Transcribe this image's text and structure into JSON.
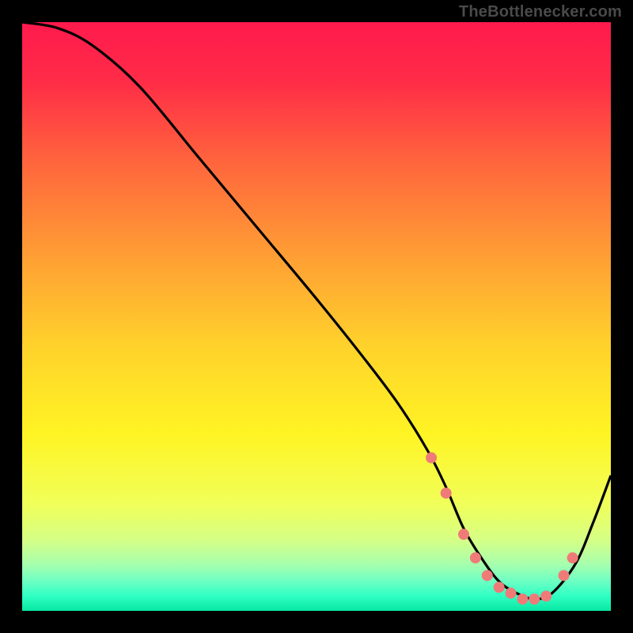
{
  "attribution": "TheBottlenecker.com",
  "chart_data": {
    "type": "line",
    "title": "",
    "xlabel": "",
    "ylabel": "",
    "xlim": [
      0,
      100
    ],
    "ylim": [
      0,
      100
    ],
    "gradient_stops": [
      {
        "offset": 0.0,
        "color": "#ff1a4d"
      },
      {
        "offset": 0.1,
        "color": "#ff2c47"
      },
      {
        "offset": 0.25,
        "color": "#ff6a3c"
      },
      {
        "offset": 0.4,
        "color": "#ff9f34"
      },
      {
        "offset": 0.55,
        "color": "#ffd22b"
      },
      {
        "offset": 0.7,
        "color": "#fff424"
      },
      {
        "offset": 0.82,
        "color": "#f0ff5a"
      },
      {
        "offset": 0.88,
        "color": "#d5ff86"
      },
      {
        "offset": 0.92,
        "color": "#a8ffad"
      },
      {
        "offset": 0.95,
        "color": "#6cffc3"
      },
      {
        "offset": 0.975,
        "color": "#2effc3"
      },
      {
        "offset": 1.0,
        "color": "#08e8a3"
      }
    ],
    "series": [
      {
        "name": "bottleneck-curve",
        "x": [
          0,
          6,
          12,
          20,
          30,
          40,
          50,
          58,
          64,
          69,
          72,
          75,
          78,
          81,
          84,
          87,
          90,
          94,
          97,
          100
        ],
        "y": [
          100,
          99,
          96,
          89,
          77,
          65,
          53,
          43,
          35,
          27,
          21,
          14,
          9,
          5,
          3,
          2,
          3,
          8,
          15,
          23
        ]
      }
    ],
    "markers": {
      "name": "dotted-segment",
      "x": [
        69.5,
        72,
        75,
        77,
        79,
        81,
        83,
        85,
        87,
        89,
        92,
        93.5
      ],
      "y": [
        26,
        20,
        13,
        9,
        6,
        4,
        3,
        2,
        2,
        2.5,
        6,
        9
      ]
    },
    "marker_style": {
      "color": "#ef7b78",
      "radius": 7
    }
  }
}
